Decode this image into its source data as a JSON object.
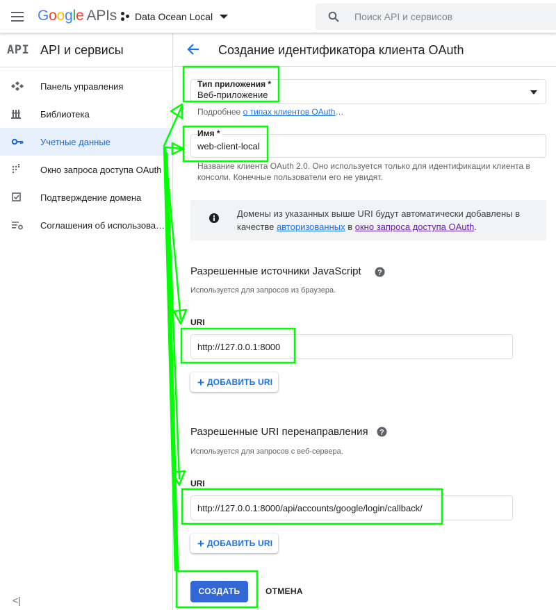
{
  "topbar": {
    "logo_letters": [
      "G",
      "o",
      "o",
      "g",
      "l",
      "e"
    ],
    "logo_suffix": "APIs",
    "project_name": "Data Ocean Local",
    "search_placeholder": "Поиск API и сервисов"
  },
  "sidebar": {
    "badge": "API",
    "title": "API и сервисы",
    "items": [
      {
        "label": "Панель управления",
        "icon": "dashboard-icon",
        "active": false
      },
      {
        "label": "Библиотека",
        "icon": "library-icon",
        "active": false
      },
      {
        "label": "Учетные данные",
        "icon": "key-icon",
        "active": true
      },
      {
        "label": "Окно запроса доступа OAuth",
        "icon": "consent-screen-icon",
        "active": false
      },
      {
        "label": "Подтверждение домена",
        "icon": "checkbox-icon",
        "active": false
      },
      {
        "label": "Соглашения об использовании",
        "icon": "agreements-icon",
        "active": false
      }
    ],
    "collapse_glyph": "<|"
  },
  "page": {
    "title": "Создание идентификатора клиента OAuth"
  },
  "form": {
    "app_type": {
      "label": "Тип приложения *",
      "value": "Веб-приложение",
      "help_prefix": "Подробнее ",
      "help_link": "о типах клиентов OAuth",
      "help_suffix": "…"
    },
    "name": {
      "label": "Имя *",
      "value": "web-client-local",
      "help": "Название клиента OAuth 2.0. Оно используется только для идентификации клиента в консоли. Конечные пользователи его не увидят."
    },
    "notice": {
      "text_1": "Домены из указанных выше URI будут автоматически добавлены в качестве ",
      "link_1": "авторизованных",
      "text_2": " в ",
      "link_2": "окно запроса доступа OAuth",
      "text_3": "."
    },
    "js_origins": {
      "title": "Разрешенные источники JavaScript",
      "subtitle": "Используется для запросов из браузера.",
      "uri_label": "URI",
      "uri_value": "http://127.0.0.1:8000",
      "add_label": "ДОБАВИТЬ URI"
    },
    "redirect_uris": {
      "title": "Разрешенные URI перенаправления",
      "subtitle": "Используется для запросов с веб-сервера.",
      "uri_label": "URI",
      "uri_value": "http://127.0.0.1:8000/api/accounts/google/login/callback/",
      "add_label": "ДОБАВИТЬ URI"
    },
    "create_label": "СОЗДАТЬ",
    "cancel_label": "ОТМЕНА"
  },
  "colors": {
    "accent": "#1a73e8",
    "primary_button": "#3367d6",
    "active_nav_bg": "#e8f0fe",
    "annotation": "#00ff00"
  }
}
